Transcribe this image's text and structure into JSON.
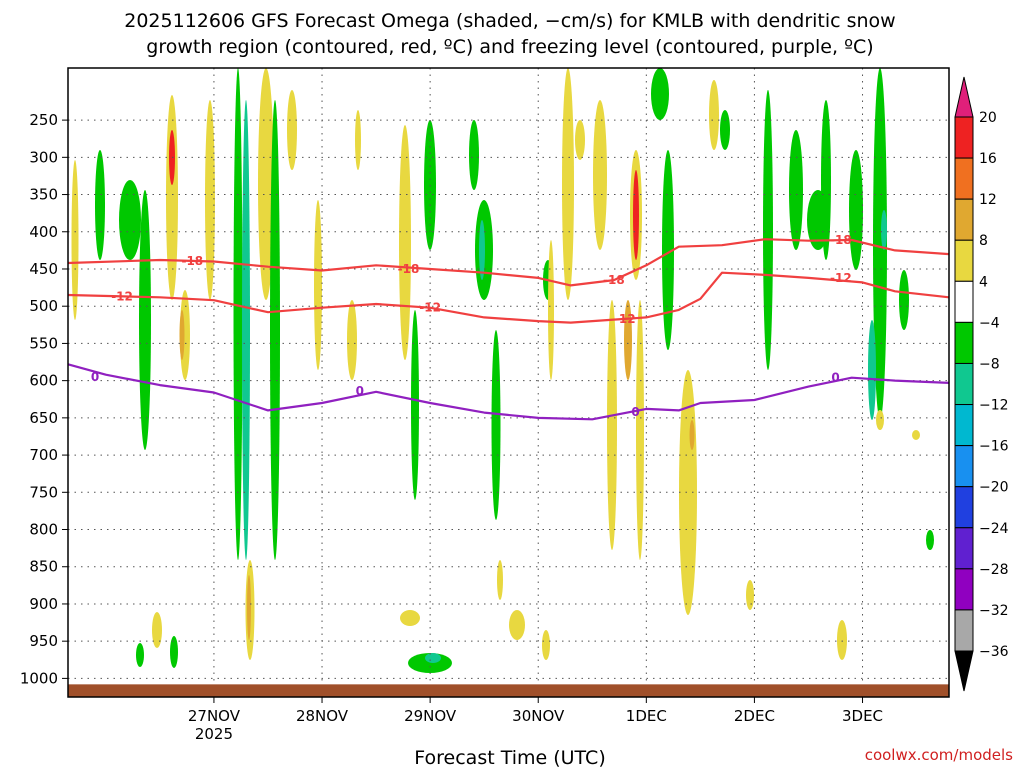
{
  "chart_data": {
    "type": "heatmap",
    "title_line1": "2025112606 GFS Forecast Omega (shaded, −cm/s) for KMLB with dendritic snow",
    "title_line2": "growth region (contoured, red, ºC) and freezing level (contoured, purple, ºC)",
    "xlabel": "Forecast Time (UTC)",
    "credit": "coolwx.com/models",
    "x_ticks": [
      {
        "label": "27NOV",
        "sub": "2025",
        "pos": 0.5
      },
      {
        "label": "28NOV",
        "sub": "",
        "pos": 1.5
      },
      {
        "label": "29NOV",
        "sub": "",
        "pos": 2.5
      },
      {
        "label": "30NOV",
        "sub": "",
        "pos": 3.5
      },
      {
        "label": "1DEC",
        "sub": "",
        "pos": 4.5
      },
      {
        "label": "2DEC",
        "sub": "",
        "pos": 5.5
      },
      {
        "label": "3DEC",
        "sub": "",
        "pos": 6.5
      }
    ],
    "xlim": [
      -0.85,
      7.3
    ],
    "ylim": [
      1025,
      180
    ],
    "y_ticks": [
      250,
      300,
      350,
      400,
      450,
      500,
      550,
      600,
      650,
      700,
      750,
      800,
      850,
      900,
      950,
      1000
    ],
    "colorbar": {
      "levels": [
        "20",
        "16",
        "12",
        "8",
        "4",
        "−4",
        "−8",
        "−12",
        "−16",
        "−20",
        "−24",
        "−28",
        "−32",
        "−36"
      ],
      "colors": [
        "#f0f0f0",
        "#ee2222",
        "#f07020",
        "#e0a830",
        "#e8d840",
        "#ffffff",
        "#00c800",
        "#10c890",
        "#00b8d0",
        "#1890f0",
        "#2040e0",
        "#6020d0",
        "#9000c0",
        "#a8a8a8"
      ],
      "top_arrow_color": "#e0207a",
      "bottom_arrow_color": "#000000"
    },
    "contours": [
      {
        "name": "-18",
        "color": "#f04040",
        "points": [
          [
            -0.85,
            442
          ],
          [
            0,
            438
          ],
          [
            0.5,
            440
          ],
          [
            1,
            447
          ],
          [
            1.5,
            452
          ],
          [
            2,
            445
          ],
          [
            2.5,
            450
          ],
          [
            3,
            455
          ],
          [
            3.5,
            462
          ],
          [
            3.8,
            472
          ],
          [
            4.2,
            465
          ],
          [
            4.5,
            445
          ],
          [
            4.8,
            420
          ],
          [
            5.2,
            418
          ],
          [
            5.6,
            410
          ],
          [
            6,
            412
          ],
          [
            6.4,
            411
          ],
          [
            6.8,
            425
          ],
          [
            7.3,
            430
          ]
        ],
        "labels": [
          [
            0.3,
            439
          ],
          [
            2.3,
            450
          ],
          [
            4.2,
            465
          ],
          [
            6.3,
            411
          ]
        ]
      },
      {
        "name": "-12",
        "color": "#f04040",
        "points": [
          [
            -0.85,
            485
          ],
          [
            0,
            488
          ],
          [
            0.5,
            492
          ],
          [
            1,
            508
          ],
          [
            1.5,
            502
          ],
          [
            2,
            497
          ],
          [
            2.5,
            502
          ],
          [
            3,
            515
          ],
          [
            3.5,
            520
          ],
          [
            3.8,
            522
          ],
          [
            4.2,
            518
          ],
          [
            4.5,
            515
          ],
          [
            4.8,
            505
          ],
          [
            5,
            490
          ],
          [
            5.2,
            455
          ],
          [
            5.6,
            458
          ],
          [
            6,
            462
          ],
          [
            6.5,
            468
          ],
          [
            6.8,
            480
          ],
          [
            7.3,
            488
          ]
        ],
        "labels": [
          [
            -0.35,
            487
          ],
          [
            2.5,
            502
          ],
          [
            4.3,
            517
          ],
          [
            6.3,
            462
          ]
        ]
      },
      {
        "name": "0",
        "color": "#9020c0",
        "points": [
          [
            -0.85,
            578
          ],
          [
            -0.5,
            592
          ],
          [
            0,
            606
          ],
          [
            0.5,
            616
          ],
          [
            1,
            640
          ],
          [
            1.5,
            630
          ],
          [
            2,
            615
          ],
          [
            2.5,
            630
          ],
          [
            3,
            643
          ],
          [
            3.5,
            650
          ],
          [
            4,
            652
          ],
          [
            4.5,
            638
          ],
          [
            4.8,
            640
          ],
          [
            5,
            630
          ],
          [
            5.5,
            626
          ],
          [
            6,
            608
          ],
          [
            6.4,
            596
          ],
          [
            6.8,
            600
          ],
          [
            7.3,
            603
          ]
        ],
        "labels": [
          [
            -0.6,
            595
          ],
          [
            1.85,
            614
          ],
          [
            4.4,
            642
          ],
          [
            6.25,
            596
          ]
        ]
      }
    ],
    "surface": {
      "color": "#a0502a",
      "top_pressure": 1008
    }
  }
}
